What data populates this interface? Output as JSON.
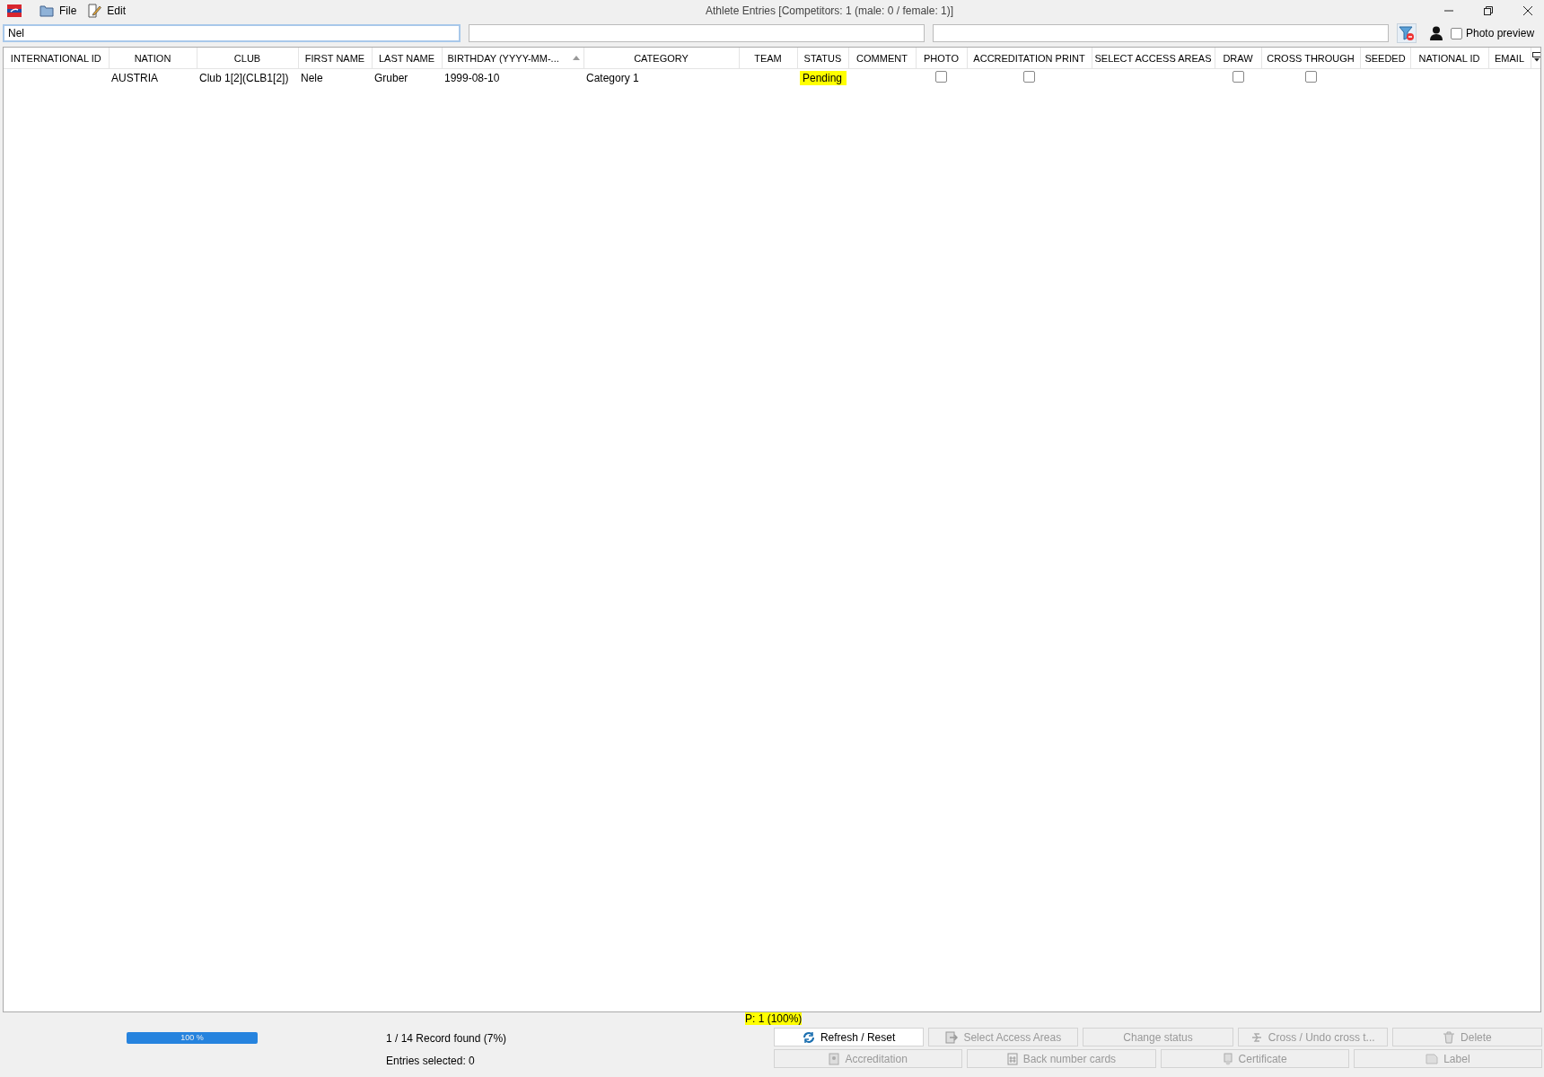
{
  "window": {
    "title": "Athlete Entries [Competitors: 1 (male: 0 / female: 1)]"
  },
  "menu": [
    {
      "label": "File",
      "kind": "file"
    },
    {
      "label": "Edit",
      "kind": "edit"
    }
  ],
  "filters": [
    {
      "value": "Nel",
      "focused": true
    },
    {
      "focused": false
    },
    {
      "focused": false
    }
  ],
  "photo_preview": {
    "label": "Photo preview",
    "checked": false
  },
  "table": {
    "columns": [
      {
        "label": "INTERNATIONAL ID",
        "sorted": false
      },
      {
        "label": "NATION",
        "sorted": false
      },
      {
        "label": "CLUB",
        "sorted": false
      },
      {
        "label": "FIRST NAME",
        "sorted": false
      },
      {
        "label": "LAST NAME",
        "sorted": false
      },
      {
        "label": "BIRTHDAY (YYYY-MM-...",
        "sorted": true
      },
      {
        "label": "CATEGORY",
        "sorted": false
      },
      {
        "label": "TEAM",
        "sorted": false
      },
      {
        "label": "STATUS",
        "sorted": false
      },
      {
        "label": "COMMENT",
        "sorted": false
      },
      {
        "label": "PHOTO",
        "sorted": false
      },
      {
        "label": "ACCREDITATION PRINT",
        "sorted": false
      },
      {
        "label": "SELECT ACCESS AREAS",
        "sorted": false
      },
      {
        "label": "DRAW",
        "sorted": false
      },
      {
        "label": "CROSS THROUGH",
        "sorted": false
      },
      {
        "label": "SEEDED",
        "sorted": false
      },
      {
        "label": "NATIONAL ID",
        "sorted": false
      },
      {
        "label": "EMAIL",
        "sorted": false
      }
    ],
    "rows": [
      {
        "cells": [
          {
            "kind": "text",
            "text": ""
          },
          {
            "kind": "text",
            "text": "AUSTRIA"
          },
          {
            "kind": "text",
            "text": "Club 1[2](CLB1[2])"
          },
          {
            "kind": "text",
            "text": "Nele"
          },
          {
            "kind": "text",
            "text": "Gruber"
          },
          {
            "kind": "text",
            "text": "1999-08-10"
          },
          {
            "kind": "text",
            "text": "Category 1"
          },
          {
            "kind": "text",
            "text": ""
          },
          {
            "kind": "status",
            "text": "Pending"
          },
          {
            "kind": "text",
            "text": ""
          },
          {
            "kind": "checkbox",
            "checked": false
          },
          {
            "kind": "checkbox",
            "checked": false
          },
          {
            "kind": "text",
            "text": ""
          },
          {
            "kind": "checkbox",
            "checked": false
          },
          {
            "kind": "checkbox",
            "checked": false
          },
          {
            "kind": "text",
            "text": ""
          },
          {
            "kind": "text",
            "text": ""
          },
          {
            "kind": "text",
            "text": ""
          }
        ]
      }
    ]
  },
  "status_bar": {
    "page_info": "P: 1 (100%)",
    "progress": {
      "level": 1,
      "label": "100 %"
    },
    "records": "1 / 14 Record found (7%)",
    "selected": "Entries selected: 0"
  },
  "buttons_row_1": [
    {
      "label": "Refresh / Reset",
      "disabled": false
    },
    {
      "label": "Select Access Areas",
      "disabled": true
    },
    {
      "label": "Change status",
      "disabled": true
    },
    {
      "label": "Cross / Undo cross t...",
      "disabled": true
    },
    {
      "label": "Delete",
      "disabled": true
    }
  ],
  "buttons_row_2": [
    {
      "label": "Accreditation",
      "disabled": true
    },
    {
      "label": "Back number cards",
      "disabled": true
    },
    {
      "label": "Certificate",
      "disabled": true
    },
    {
      "label": "Label",
      "disabled": true
    }
  ]
}
